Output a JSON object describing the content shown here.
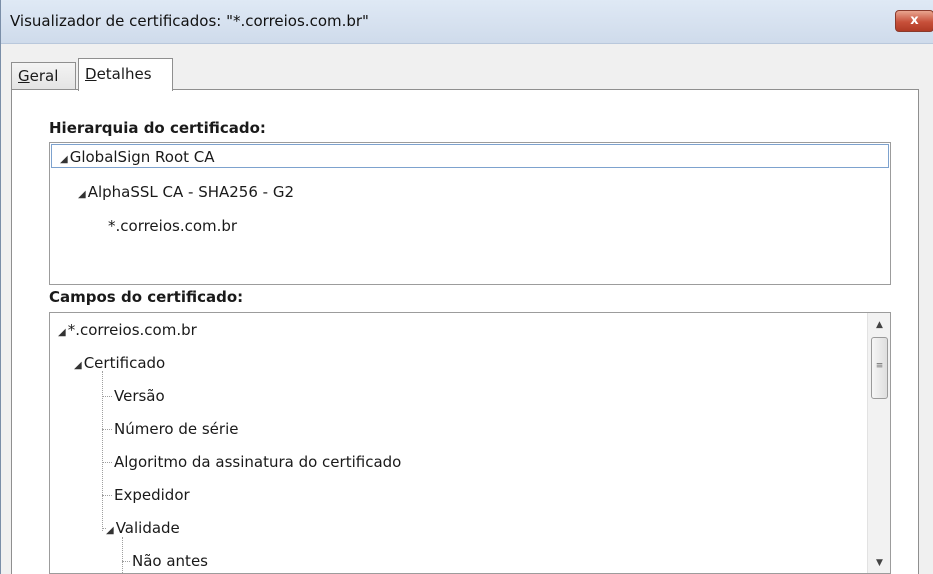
{
  "window": {
    "title": "Visualizador de certificados: \"*.correios.com.br\"",
    "close_glyph": "x"
  },
  "tabs": [
    {
      "label_underlined": "G",
      "label_rest": "eral",
      "active": false
    },
    {
      "label_underlined": "D",
      "label_rest": "etalhes",
      "active": true
    }
  ],
  "hierarchy": {
    "label": "Hierarquia do certificado:",
    "items": [
      {
        "label": "GlobalSign Root CA",
        "expanded": true
      },
      {
        "label": "AlphaSSL CA - SHA256 - G2",
        "expanded": true
      },
      {
        "label": "*.correios.com.br"
      }
    ]
  },
  "fields": {
    "label": "Campos do certificado:",
    "items": [
      {
        "label": "*.correios.com.br",
        "expanded": true
      },
      {
        "label": "Certificado",
        "expanded": true
      },
      {
        "label": "Versão"
      },
      {
        "label": "Número de série"
      },
      {
        "label": "Algoritmo da assinatura do certificado"
      },
      {
        "label": "Expedidor"
      },
      {
        "label": "Validade",
        "expanded": true
      },
      {
        "label": "Não antes"
      }
    ]
  },
  "icons": {
    "expanded_triangle": "◢",
    "scroll_up": "▲",
    "scroll_down": "▼",
    "scroll_grip": "≡"
  },
  "colors": {
    "titlebar": "#d9e4f1",
    "close_button": "#c7503a",
    "selection_border": "#7da2ce"
  }
}
